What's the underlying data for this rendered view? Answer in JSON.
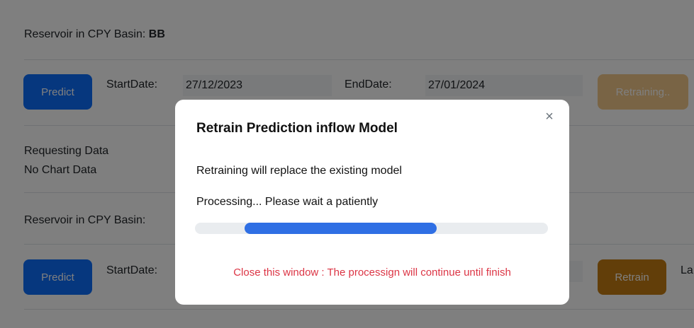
{
  "section1": {
    "title_prefix": "Reservoir in CPY Basin: ",
    "basin_code": "BB",
    "predict_label": "Predict",
    "start_label": "StartDate:",
    "start_value": "27/12/2023",
    "end_label": "EndDate:",
    "end_value": "27/01/2024",
    "retrain_label": "Retraining..",
    "status_line1": "Requesting Data",
    "status_line2": "No Chart Data"
  },
  "section2": {
    "title_prefix": "Reservoir in CPY Basin:",
    "predict_label": "Predict",
    "start_label": "StartDate:",
    "retrain_label": "Retrain",
    "trailing_text": "La"
  },
  "modal": {
    "title": "Retrain Prediction inflow Model",
    "close_symbol": "×",
    "line1": "Retraining will replace the existing model",
    "line2": "Processing... Please wait a patiently",
    "warning": "Close this window : The processign will continue until finish",
    "progress_start": 0.14,
    "progress_end": 0.685
  },
  "colors": {
    "primary": "#0d6efd",
    "warning": "#c47d12",
    "danger": "#dc3545",
    "progress": "#2f6fe4"
  }
}
